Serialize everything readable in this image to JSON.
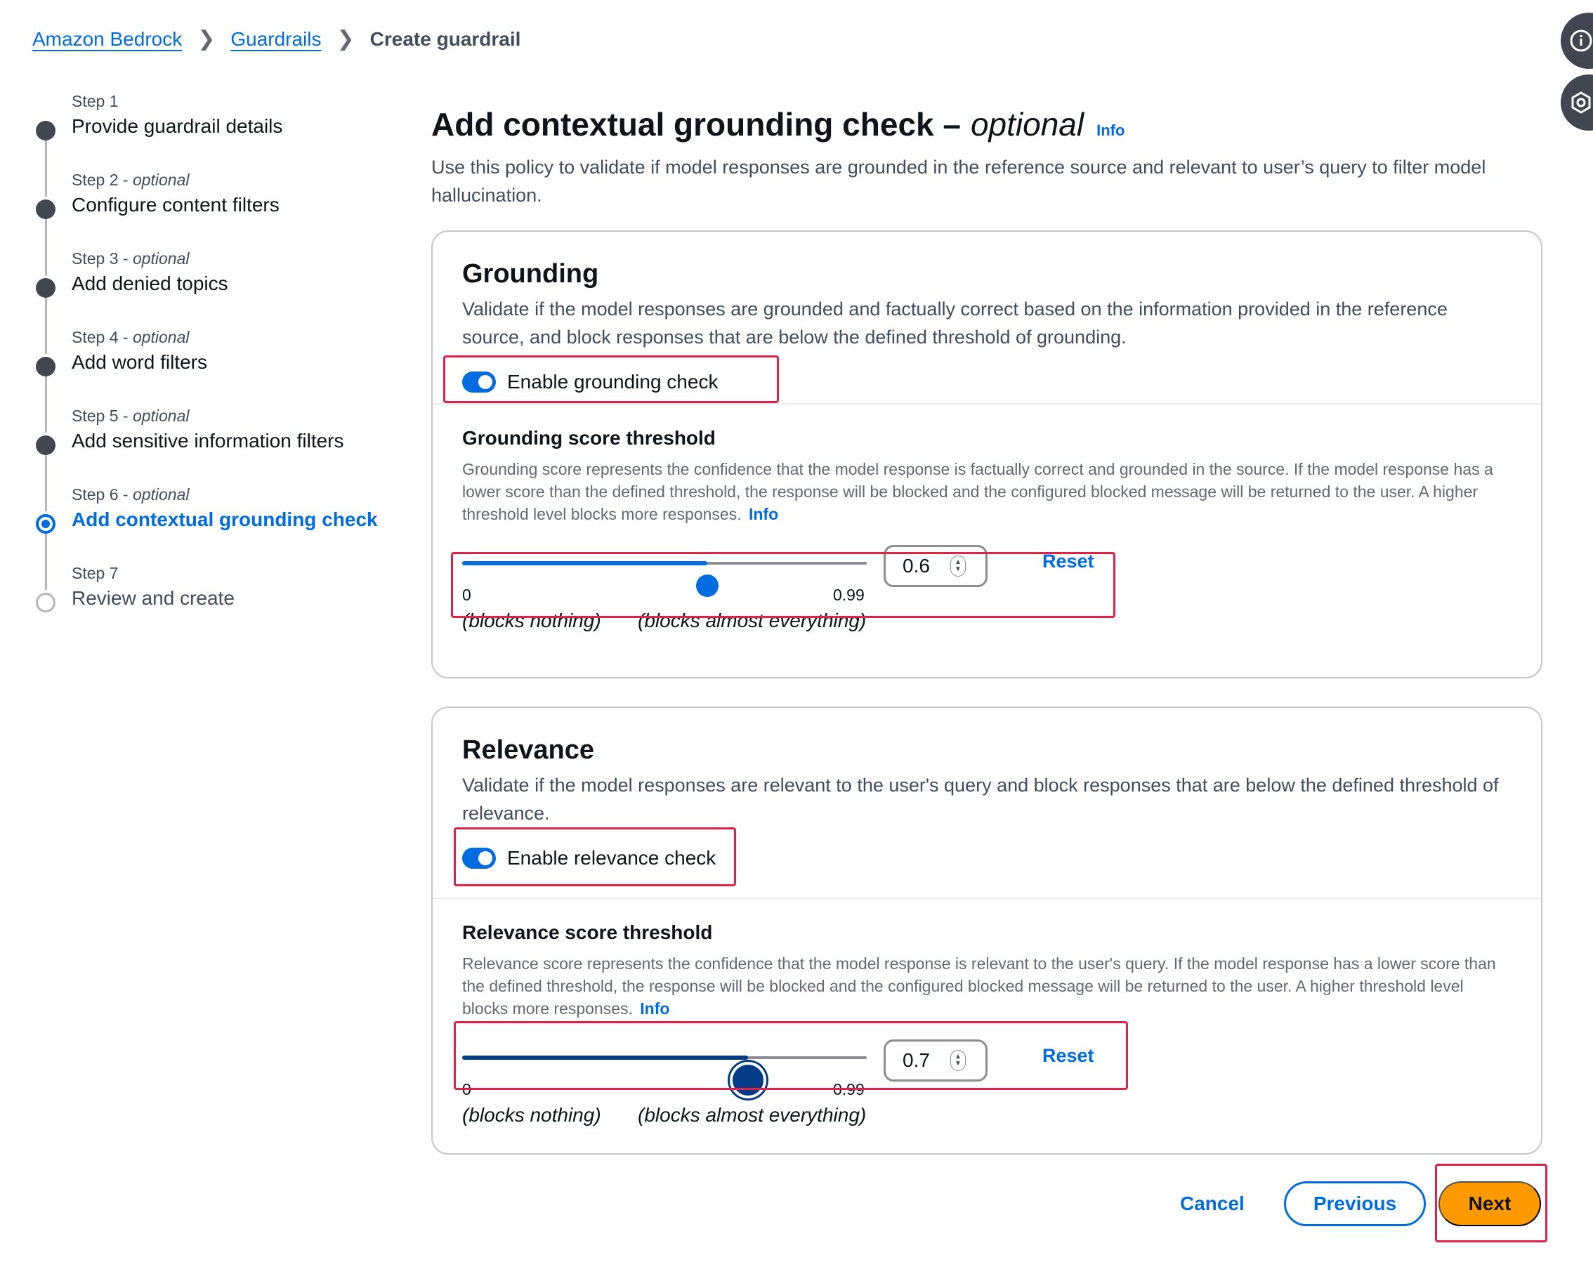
{
  "breadcrumb": {
    "items": [
      "Amazon Bedrock",
      "Guardrails"
    ],
    "current": "Create guardrail"
  },
  "side_icons": [
    "info-icon",
    "hex-icon"
  ],
  "wizard": {
    "steps": [
      {
        "num": "Step 1",
        "opt": "",
        "title": "Provide guardrail details",
        "state": "done"
      },
      {
        "num": "Step 2 - ",
        "opt": "optional",
        "title": "Configure content filters",
        "state": "done"
      },
      {
        "num": "Step 3 - ",
        "opt": "optional",
        "title": "Add denied topics",
        "state": "done"
      },
      {
        "num": "Step 4 - ",
        "opt": "optional",
        "title": "Add word filters",
        "state": "done"
      },
      {
        "num": "Step 5 - ",
        "opt": "optional",
        "title": "Add sensitive information filters",
        "state": "done"
      },
      {
        "num": "Step 6 - ",
        "opt": "optional",
        "title": "Add contextual grounding check",
        "state": "active"
      },
      {
        "num": "Step 7",
        "opt": "",
        "title": "Review and create",
        "state": "pending"
      }
    ]
  },
  "page": {
    "title": "Add contextual grounding check –",
    "title_optional": "optional",
    "info": "Info",
    "description": "Use this policy to validate if model responses are grounded in the reference source and relevant to user’s query to filter model hallucination."
  },
  "grounding": {
    "title": "Grounding",
    "description": "Validate if the model responses are grounded and factually correct based on the information provided in the reference source, and block responses that are below the defined threshold of grounding.",
    "toggle_label": "Enable grounding check",
    "toggle_on": true,
    "threshold_label": "Grounding score threshold",
    "threshold_desc": "Grounding score represents the confidence that the model response is factually correct and grounded in the source. If the model response has a lower score than the defined threshold, the response will be blocked and the configured blocked message will be returned to the user. A higher threshold level blocks more responses.",
    "info": "Info",
    "value": "0.6",
    "slider_value": 0.6,
    "min": "0",
    "max": "0.99",
    "reset": "Reset",
    "low_label": "(blocks nothing)",
    "high_label": "(blocks almost everything)"
  },
  "relevance": {
    "title": "Relevance",
    "description": "Validate if the model responses are relevant to the user's query and block responses that are below the defined threshold of relevance.",
    "toggle_label": "Enable relevance check",
    "toggle_on": true,
    "threshold_label": "Relevance score threshold",
    "threshold_desc": "Relevance score represents the confidence that the model response is relevant to the user's query. If the model response has a lower score than the defined threshold, the response will be blocked and the configured blocked message will be returned to the user. A higher threshold level blocks more responses.",
    "info": "Info",
    "value": "0.7",
    "slider_value": 0.7,
    "min": "0",
    "max": "0.99",
    "reset": "Reset",
    "low_label": "(blocks nothing)",
    "high_label": "(blocks almost everything)"
  },
  "footer": {
    "cancel": "Cancel",
    "previous": "Previous",
    "next": "Next"
  },
  "colors": {
    "accent": "#006ce0",
    "highlight": "#e0224b",
    "primary_button": "#ff9900"
  }
}
